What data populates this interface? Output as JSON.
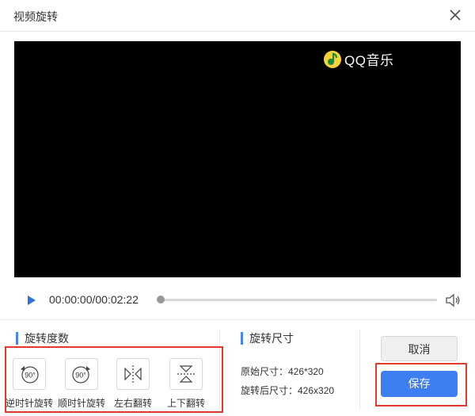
{
  "window": {
    "title": "视频旋转"
  },
  "video": {
    "watermark_text": "QQ音乐",
    "watermark_icon": "qq-music-logo-icon"
  },
  "player": {
    "time": "00:00:00/00:02:22",
    "progress_fraction": 0.0
  },
  "rotation": {
    "section_title": "旋转度数",
    "tools": [
      {
        "icon": "rotate-ccw-90-icon",
        "icon_text": "90°",
        "label": "逆时针旋转"
      },
      {
        "icon": "rotate-cw-90-icon",
        "icon_text": "90°",
        "label": "顺时针旋转"
      },
      {
        "icon": "flip-horizontal-icon",
        "label": "左右翻转"
      },
      {
        "icon": "flip-vertical-icon",
        "label": "上下翻转"
      }
    ]
  },
  "size": {
    "section_title": "旋转尺寸",
    "original": "原始尺寸：426*320",
    "rotated": "旋转后尺寸：426x320"
  },
  "buttons": {
    "cancel": "取消",
    "save": "保存"
  },
  "colors": {
    "accent": "#3d7ff0",
    "highlight": "#e23b2e",
    "section_bar": "#4a86e8",
    "logo": "#f6d23a"
  }
}
